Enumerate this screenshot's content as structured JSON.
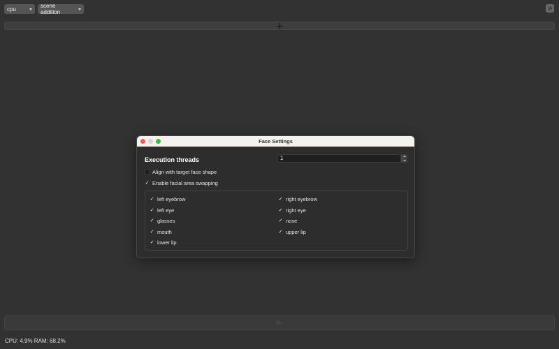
{
  "topbar": {
    "device_select": "cpu",
    "mode_select": "scene addition"
  },
  "icons": {
    "settings": "gear-icon",
    "add": "plus-icon",
    "run": "play-icon"
  },
  "status": "CPU: 4.9%  RAM: 68.2%",
  "dialog": {
    "title": "Face Settings",
    "execution_threads_label": "Execution threads",
    "execution_threads_value": "1",
    "align_face_shape": {
      "label": "Align with target face shape",
      "checked": false
    },
    "facial_area_swapping": {
      "label": "Enable facial area swapping",
      "checked": true
    },
    "regions": [
      {
        "label": "left eyebrow",
        "checked": true
      },
      {
        "label": "right eyebrow",
        "checked": true
      },
      {
        "label": "left eye",
        "checked": true
      },
      {
        "label": "right eye",
        "checked": true
      },
      {
        "label": "glasses",
        "checked": true
      },
      {
        "label": "nose",
        "checked": true
      },
      {
        "label": "mouth",
        "checked": true
      },
      {
        "label": "upper lip",
        "checked": true
      },
      {
        "label": "lower lip",
        "checked": true
      }
    ],
    "check_glyph": "✓"
  },
  "colors": {
    "background": "#323232",
    "close_button": "#ef5f57",
    "maximize_button": "#32c048"
  }
}
